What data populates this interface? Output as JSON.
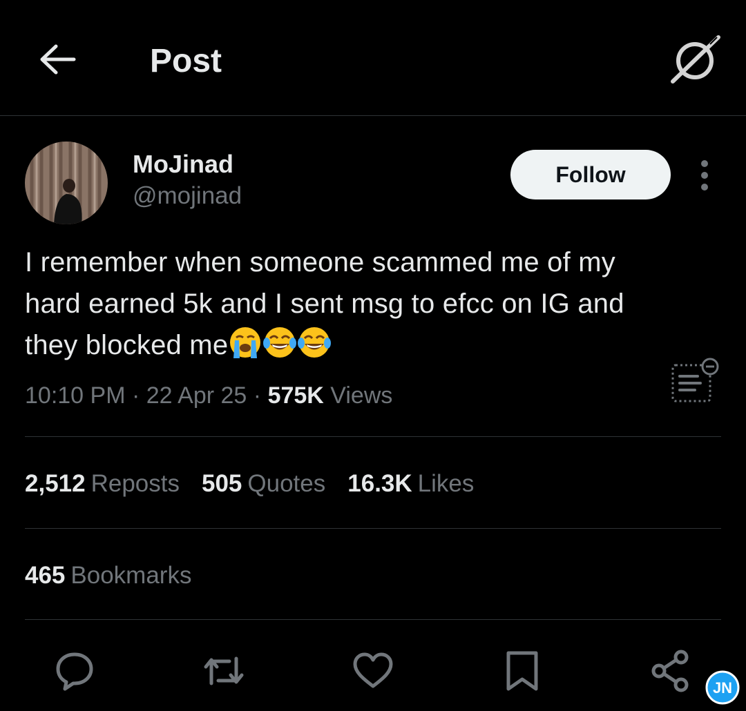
{
  "header": {
    "title": "Post"
  },
  "author": {
    "display_name": "MoJinad",
    "handle": "@mojinad",
    "follow_label": "Follow"
  },
  "tweet": {
    "line1": "I remember when someone scammed me of my",
    "line2": "hard earned 5k and I sent msg to efcc on IG and",
    "line3": "they blocked me",
    "emojis": [
      "loudly-crying-face",
      "face-with-tears-of-joy",
      "face-with-tears-of-joy"
    ],
    "time": "10:10 PM",
    "date": "22 Apr 25",
    "views_count": "575K",
    "views_label": "Views",
    "sep": "·"
  },
  "stats": {
    "reposts_count": "2,512",
    "reposts_label": "Reposts",
    "quotes_count": "505",
    "quotes_label": "Quotes",
    "likes_count": "16.3K",
    "likes_label": "Likes",
    "bookmarks_count": "465",
    "bookmarks_label": "Bookmarks"
  },
  "actions": [
    "reply-icon",
    "repost-icon",
    "like-icon",
    "bookmark-icon",
    "share-icon"
  ],
  "watermark": {
    "text": "JN"
  },
  "colors": {
    "background": "#000000",
    "text": "#e7e9ea",
    "secondary": "#71767b",
    "divider": "#2f3336",
    "follow_bg": "#eff3f4"
  }
}
